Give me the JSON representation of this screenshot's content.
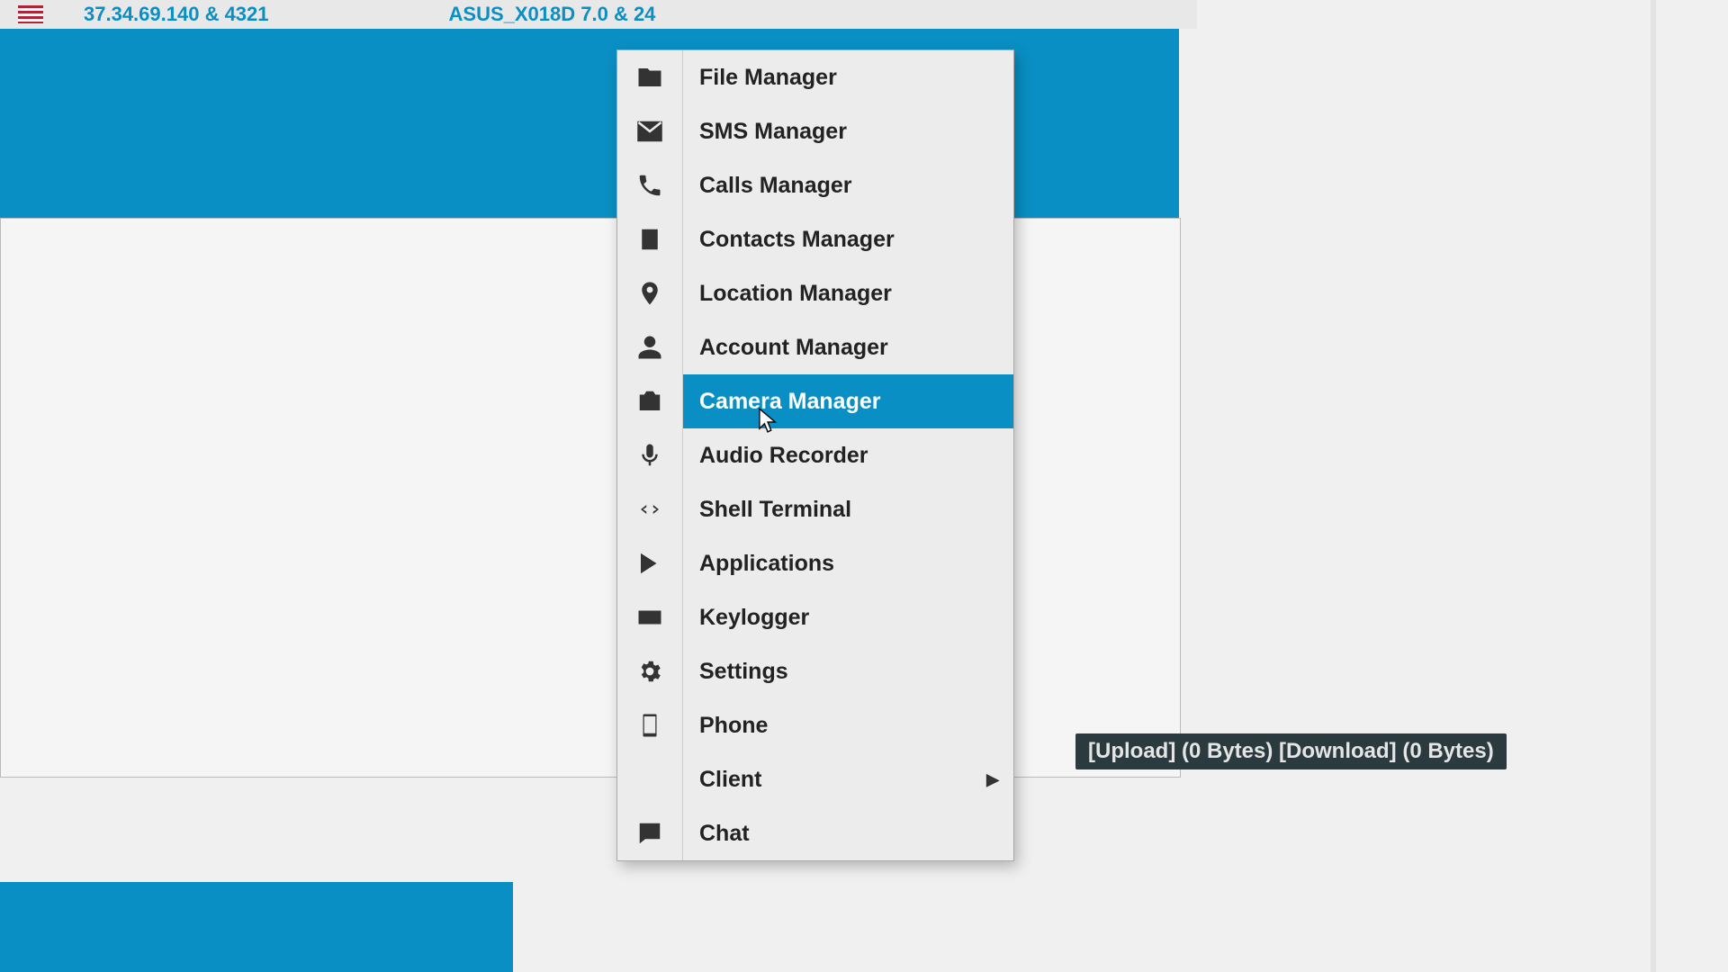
{
  "topbar": {
    "ip_text": "37.34.69.140 & 4321",
    "device_text": "ASUS_X018D  7.0 & 24"
  },
  "menu": {
    "items": [
      {
        "label": "File Manager",
        "icon": "folder-icon"
      },
      {
        "label": "SMS Manager",
        "icon": "mail-icon"
      },
      {
        "label": "Calls Manager",
        "icon": "phone-call-icon"
      },
      {
        "label": "Contacts Manager",
        "icon": "building-icon"
      },
      {
        "label": "Location Manager",
        "icon": "location-pin-icon"
      },
      {
        "label": "Account Manager",
        "icon": "person-icon"
      },
      {
        "label": "Camera Manager",
        "icon": "camera-icon",
        "selected": true
      },
      {
        "label": "Audio Recorder",
        "icon": "microphone-icon"
      },
      {
        "label": "Shell Terminal",
        "icon": "code-icon"
      },
      {
        "label": "Applications",
        "icon": "play-store-icon"
      },
      {
        "label": "Keylogger",
        "icon": "keyboard-icon"
      },
      {
        "label": "Settings",
        "icon": "gear-icon"
      },
      {
        "label": "Phone",
        "icon": "smartphone-icon"
      },
      {
        "label": "Client",
        "icon": "",
        "submenu": true
      },
      {
        "label": "Chat",
        "icon": "chat-icon"
      }
    ]
  },
  "status": {
    "text": "[Upload] (0 Bytes) [Download] (0 Bytes)"
  }
}
